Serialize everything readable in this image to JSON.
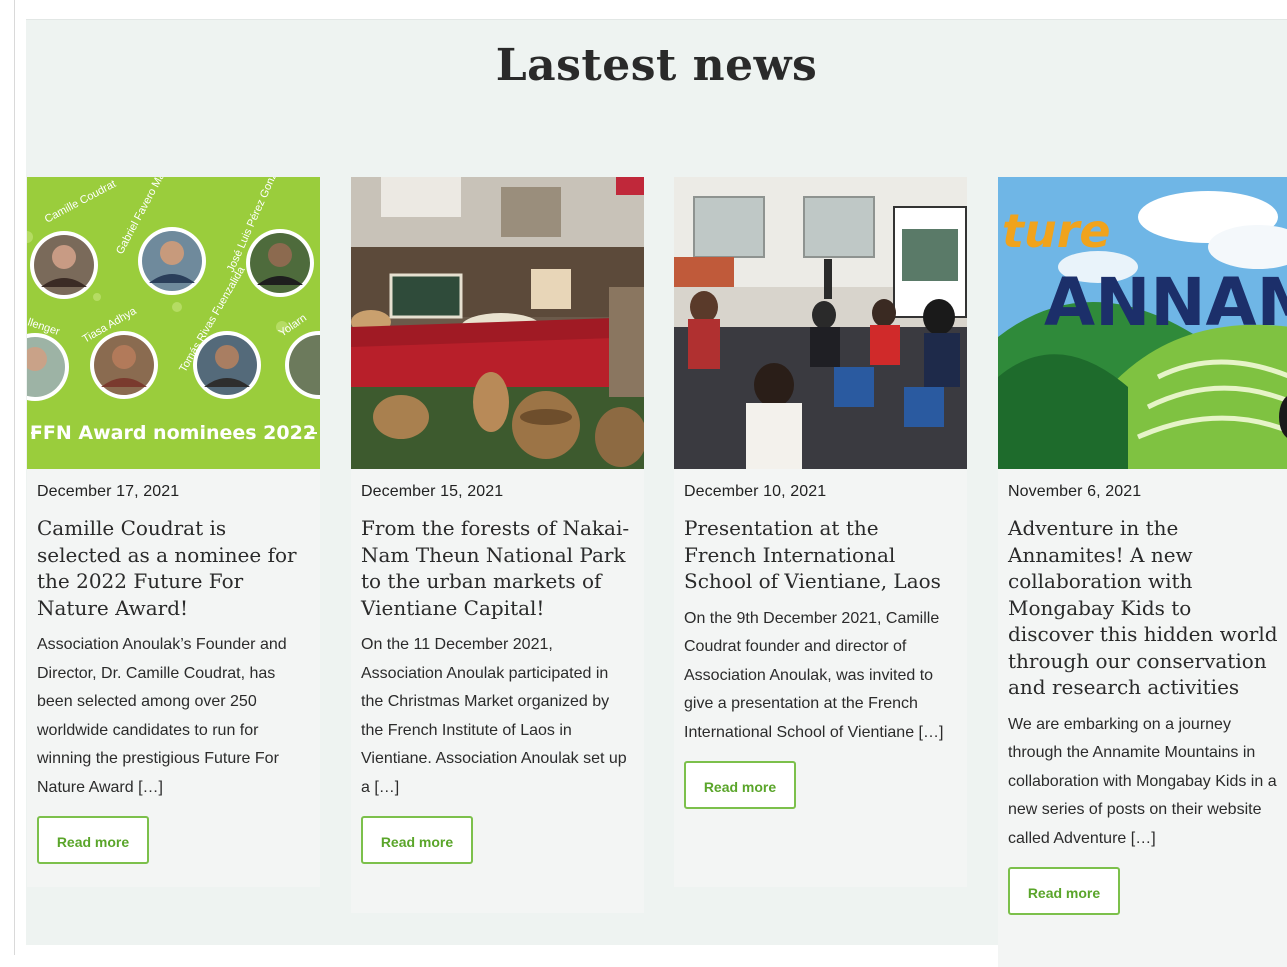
{
  "section": {
    "title": "Lastest news"
  },
  "colors": {
    "accent": "#7cc04b",
    "background": "#eef3f1",
    "card": "#f3f5f4"
  },
  "cards": [
    {
      "image_alt": "FFN Award nominees 2022 collage",
      "image_caption": "FFN Award nominees 2022",
      "image_names": [
        "Camille Coudrat",
        "Gabriel Favero Massocato",
        "José Luis Pérez Gonz",
        "llenger",
        "Tiasa Adhya",
        "Tomás Rivas Fuenzalida",
        "Yolarn"
      ],
      "date": "December 17, 2021",
      "title": "Camille Coudrat is selected as a nominee for the 2022 Future For Nature Award!",
      "excerpt": "Association Anoulak’s Founder and Director, Dr. Camille Coudrat, has been selected among over 250 worldwide candidates to run for winning the prestigious Future For Nature Award […]",
      "button": "Read more"
    },
    {
      "image_alt": "Market stall with baskets",
      "date": "December 15, 2021",
      "title": "From the forests of Nakai-Nam Theun National Park to the urban markets of Vientiane Capital!",
      "excerpt": "On the 11 December 2021, Association Anoulak participated in the Christmas Market organized by the French Institute of Laos in Vientiane. Association Anoulak set up a […]",
      "button": "Read more"
    },
    {
      "image_alt": "Presentation in a classroom",
      "date": "December 10, 2021",
      "title": "Presentation at the French International School of Vientiane, Laos",
      "excerpt": "On the 9th December 2021, Camille Coudrat founder and director of Association Anoulak, was invited to give a presentation at the French International School of Vientiane […]",
      "button": "Read more"
    },
    {
      "image_alt": "Adventure Annamites banner",
      "image_text_1": "ture",
      "image_text_2": "ANNAM",
      "date": "November 6, 2021",
      "title": "Adventure in the Annamites! A new collaboration with Mongabay Kids to discover this hidden world through our conservation and research activities",
      "excerpt": "We are embarking on a journey through the Annamite Mountains in collaboration with Mongabay Kids in a new series of posts on their website called Adventure […]",
      "button": "Read more"
    }
  ]
}
